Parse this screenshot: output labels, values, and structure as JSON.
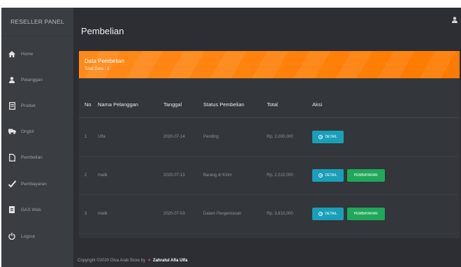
{
  "sidebar": {
    "brand": "RESELLER PANEL",
    "items": [
      {
        "label": "Home",
        "icon": "home-icon"
      },
      {
        "label": "Pelanggan",
        "icon": "user-icon"
      },
      {
        "label": "Produk",
        "icon": "document-icon"
      },
      {
        "label": "Ongkir",
        "icon": "truck-icon"
      },
      {
        "label": "Pembelian",
        "icon": "file-icon"
      },
      {
        "label": "Pembayaran",
        "icon": "check-icon"
      },
      {
        "label": "GAS Web",
        "icon": "report-icon"
      },
      {
        "label": "Logout",
        "icon": "power-icon"
      }
    ]
  },
  "header": {
    "page_title": "Pembelian",
    "user_icon": "user-icon"
  },
  "card": {
    "title": "Data Pembelian",
    "subtitle": "Total Data : 3",
    "accent": "#ff8000"
  },
  "table": {
    "columns": [
      "No",
      "Nama Pelanggan",
      "Tanggal",
      "Status Pembelian",
      "Total",
      "Aksi"
    ],
    "rows": [
      {
        "no": "1",
        "name": "Ulfa",
        "date": "2020-07-14",
        "status": "Pending",
        "total": "Rp. 2,000,000",
        "detail": "DETAIL",
        "pay": ""
      },
      {
        "no": "2",
        "name": "malik",
        "date": "2020-07-13",
        "status": "Barang di Kirim",
        "total": "Rp. 2,010,000",
        "detail": "DETAIL",
        "pay": "PEMBAYARAN"
      },
      {
        "no": "3",
        "name": "malik",
        "date": "2020-07-03",
        "status": "Dalam Pengemasan",
        "total": "Rp. 3,610,000",
        "detail": "DETAIL",
        "pay": "PEMBAYARAN"
      }
    ]
  },
  "footer": {
    "text": "Copyright ©2020 Olva Arab Store by",
    "author": "Zahratul Afia Ulfa"
  },
  "colors": {
    "sidebar_bg": "#3a3d42",
    "main_bg": "#2c2e33",
    "detail_button": "#1a9fb9",
    "pay_button": "#1fa85a"
  }
}
